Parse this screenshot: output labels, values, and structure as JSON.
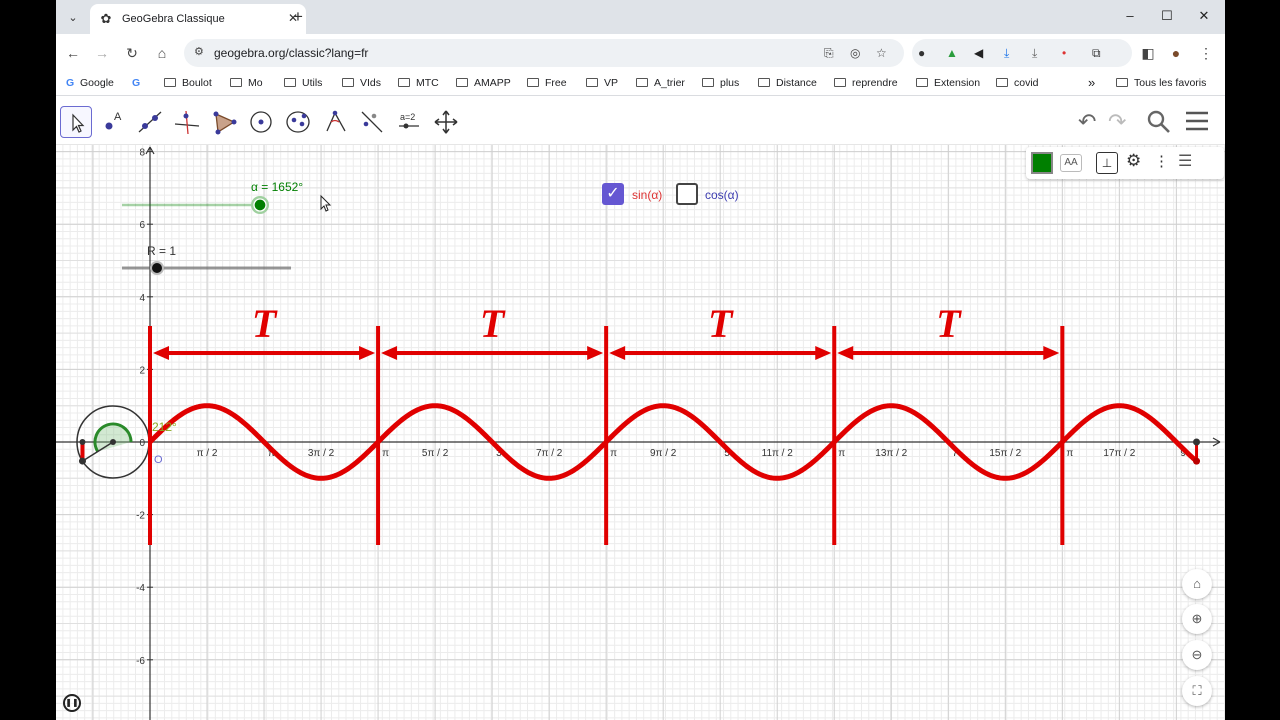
{
  "browser": {
    "tab_title": "GeoGebra Classique",
    "url": "geogebra.org/classic?lang=fr",
    "bookmarks": [
      "Google",
      "Boulot",
      "Mo",
      "Utils",
      "VIds",
      "MTC",
      "AMAPP",
      "Free",
      "VP",
      "A_trier",
      "plus",
      "Distance",
      "reprendre",
      "Extension",
      "covid"
    ],
    "bookmarks_more": "»",
    "all_bookmarks": "Tous les favoris"
  },
  "ggb": {
    "slider_alpha_label": "α = 1652°",
    "slider_alpha_value": 1652,
    "slider_r_label": "R = 1",
    "slider_r_value": 1,
    "angle_label": "212°",
    "origin_label": "O",
    "checkbox_sin_label": "sin(α)",
    "checkbox_sin_checked": true,
    "checkbox_cos_label": "cos(α)",
    "checkbox_cos_checked": false,
    "y_ticks": [
      "8",
      "6",
      "4",
      "2",
      "0",
      "-2",
      "-4",
      "-6"
    ],
    "x_ticks_visible": [
      "π / 2",
      "3π / 2",
      "5π / 2",
      "7π / 2",
      "9π / 2",
      "11π / 2",
      "13π / 2",
      "15π / 2",
      "17π / 2"
    ],
    "x_ticks_partial": [
      "π",
      "π",
      "3",
      "π",
      "5",
      "π",
      "7",
      "π",
      "9"
    ],
    "period_label": "T",
    "accent_red": "#e00000",
    "accent_green": "#007f00",
    "cos_color": "#3c3cb0"
  },
  "chart_data": {
    "type": "line",
    "function": "sin(x)",
    "x_range_rad": [
      0,
      28.83
    ],
    "y_range": [
      -7.8,
      8.2
    ],
    "series": [
      {
        "name": "sin(α)",
        "color": "#e00000"
      }
    ],
    "period_markers_rad": [
      0,
      6.283,
      12.566,
      18.85,
      25.133
    ],
    "period_annotation": "T"
  }
}
